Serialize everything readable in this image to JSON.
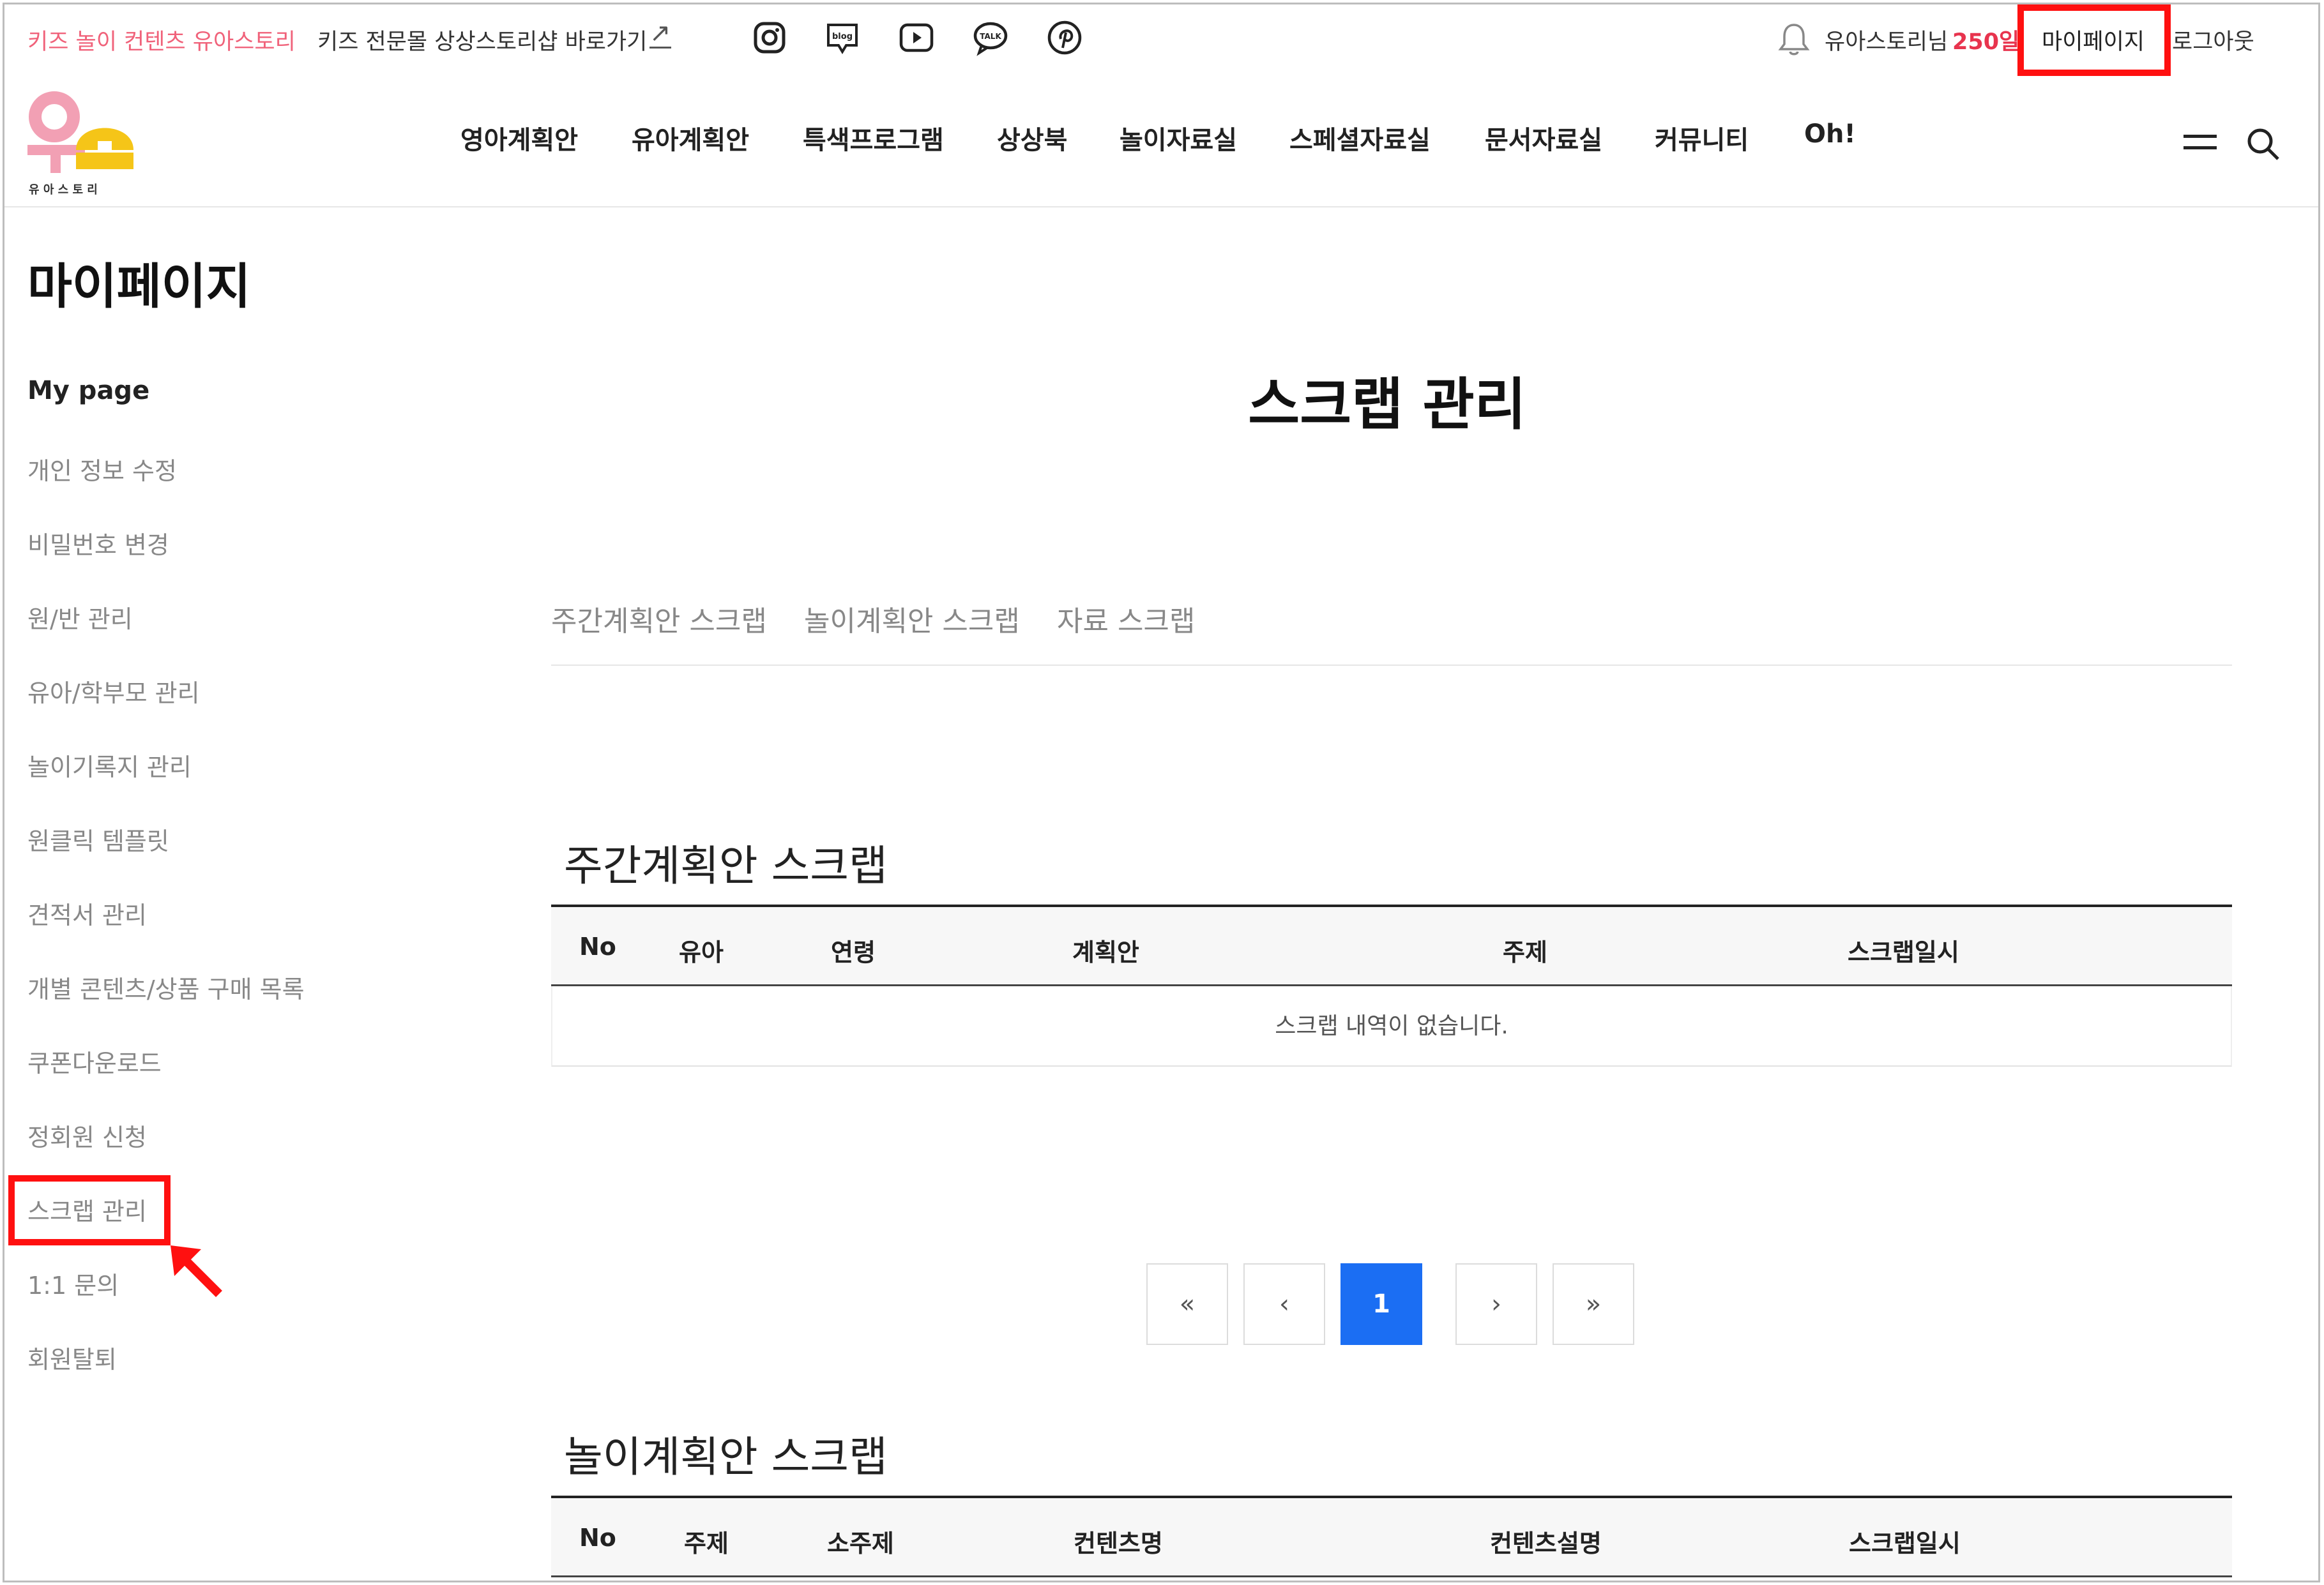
{
  "topbar": {
    "brand_text": "키즈 놀이 컨텐츠 유아스토리",
    "shop_link": "키즈 전문몰 상상스토리샵 바로가기",
    "shop_arrow": "↗",
    "user_name": "유아스토리님",
    "user_points": "250일",
    "mypage": "마이페이지",
    "logout": "로그아웃"
  },
  "sns": [
    "instagram-icon",
    "blog-icon",
    "youtube-icon",
    "talk-icon",
    "pinterest-icon"
  ],
  "sns_labels": {
    "blog": "blog",
    "talk": "TALK"
  },
  "logo": {
    "text": "유 아 스 토 리"
  },
  "nav": {
    "items": [
      "영아계획안",
      "유아계획안",
      "특색프로그램",
      "상상북",
      "놀이자료실",
      "스페셜자료실",
      "문서자료실",
      "커뮤니티",
      "Oh!"
    ]
  },
  "sidebar": {
    "page_title": "마이페이지",
    "heading": "My page",
    "items": [
      "개인 정보 수정",
      "비밀번호 변경",
      "원/반 관리",
      "유아/학부모 관리",
      "놀이기록지 관리",
      "원클릭 템플릿",
      "견적서 관리",
      "개별 콘텐츠/상품 구매 목록",
      "쿠폰다운로드",
      "정회원 신청",
      "스크랩 관리",
      "1:1 문의",
      "회원탈퇴"
    ]
  },
  "main": {
    "title": "스크랩 관리",
    "tabs": [
      "주간계획안 스크랩",
      "놀이계획안 스크랩",
      "자료 스크랩"
    ]
  },
  "weekly": {
    "title": "주간계획안 스크랩",
    "headers": [
      "No",
      "유아",
      "연령",
      "계획안",
      "주제",
      "스크랩일시"
    ],
    "empty": "스크랩 내역이 없습니다."
  },
  "pagination": {
    "first": "«",
    "prev": "‹",
    "current": "1",
    "next": "›",
    "last": "»"
  },
  "play": {
    "title": "놀이계획안 스크랩",
    "headers": [
      "No",
      "주제",
      "소주제",
      "컨텐츠명",
      "컨텐츠설명",
      "스크랩일시"
    ]
  },
  "colors": {
    "accent_pink": "#f0627a",
    "points_red": "#e8344e",
    "highlight_red": "#ff1010",
    "page_active_blue": "#1b6ef3",
    "logo_pink": "#f2a0b4",
    "logo_yellow": "#f5c518"
  }
}
